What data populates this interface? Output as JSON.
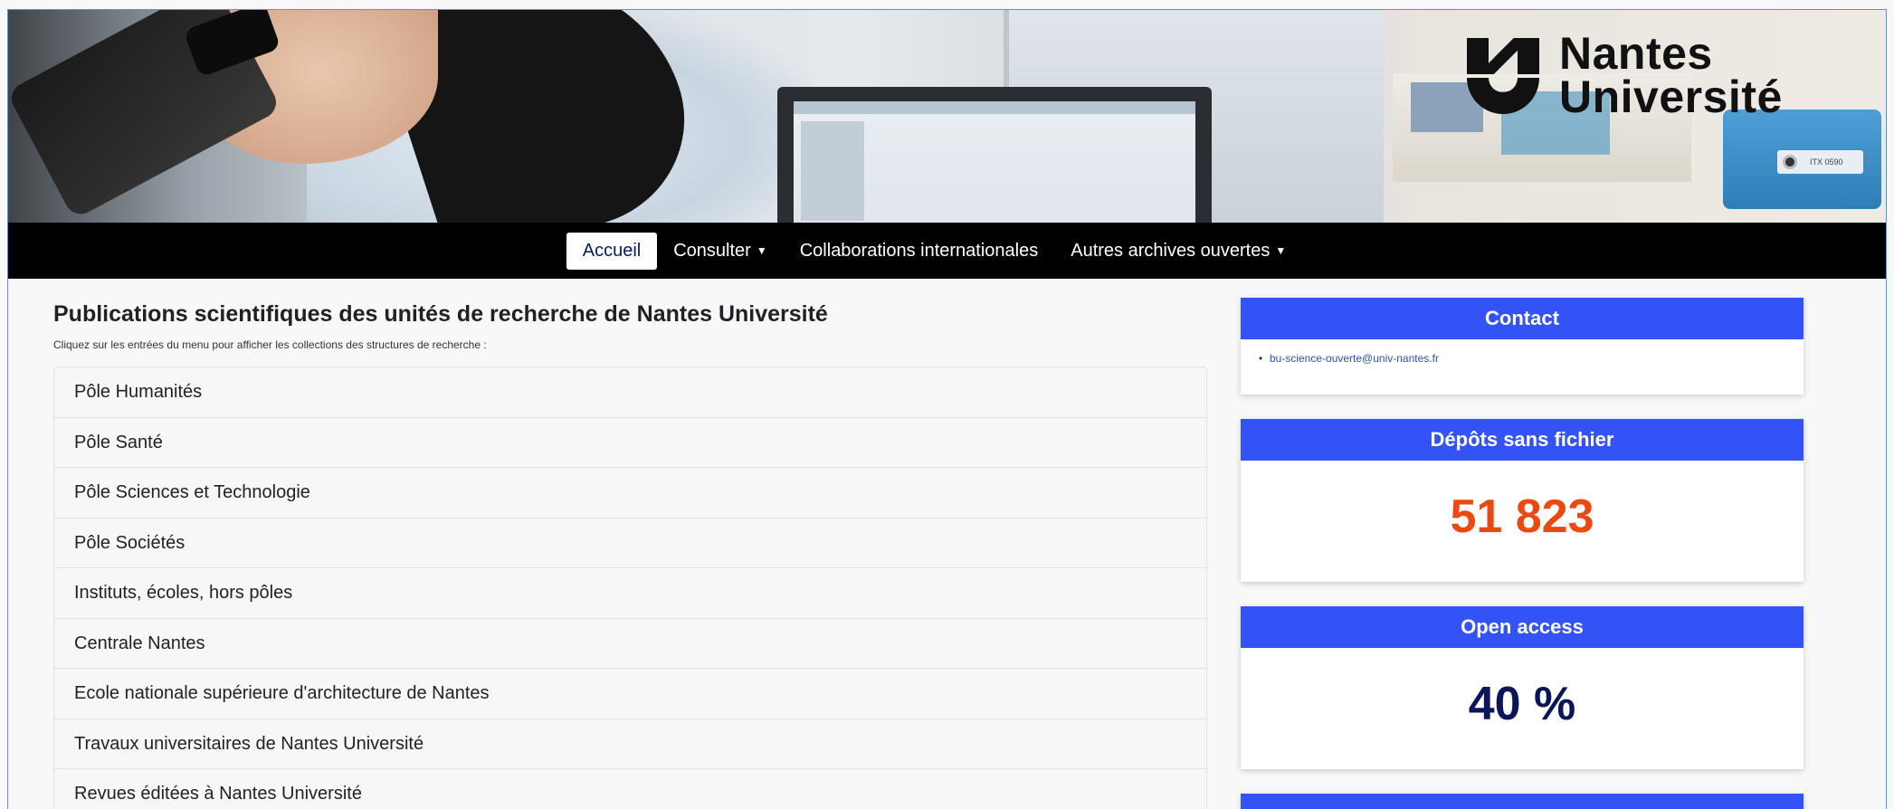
{
  "banner": {
    "logo_line1": "Nantes",
    "logo_line2": "Université",
    "device_label": "ITX 0590"
  },
  "nav": {
    "items": [
      {
        "label": "Accueil",
        "active": true
      },
      {
        "label": "Consulter",
        "dropdown": true
      },
      {
        "label": "Collaborations internationales"
      },
      {
        "label": "Autres archives ouvertes",
        "dropdown": true
      }
    ]
  },
  "main": {
    "title": "Publications scientifiques des unités de recherche de Nantes Université",
    "subtitle": "Cliquez sur les entrées du menu pour afficher les collections des structures de recherche :",
    "rows": [
      "Pôle Humanités",
      "Pôle Santé",
      "Pôle Sciences et Technologie",
      "Pôle Sociétés",
      "Instituts, écoles, hors pôles",
      "Centrale Nantes",
      "Ecole nationale supérieure d'architecture de Nantes",
      "Travaux universitaires de Nantes Université",
      "Revues éditées à Nantes Université"
    ]
  },
  "sidebar": {
    "contact": {
      "title": "Contact",
      "email": "bu-science-ouverte@univ-nantes.fr"
    },
    "depots": {
      "title": "Dépôts sans fichier",
      "value": "51 823"
    },
    "open_access": {
      "title": "Open access",
      "value": "40 %"
    }
  },
  "colors": {
    "nav_bg": "#000000",
    "card_header": "#3453f6",
    "depots_value": "#ea4a12",
    "openaccess_value": "#0b1658"
  }
}
